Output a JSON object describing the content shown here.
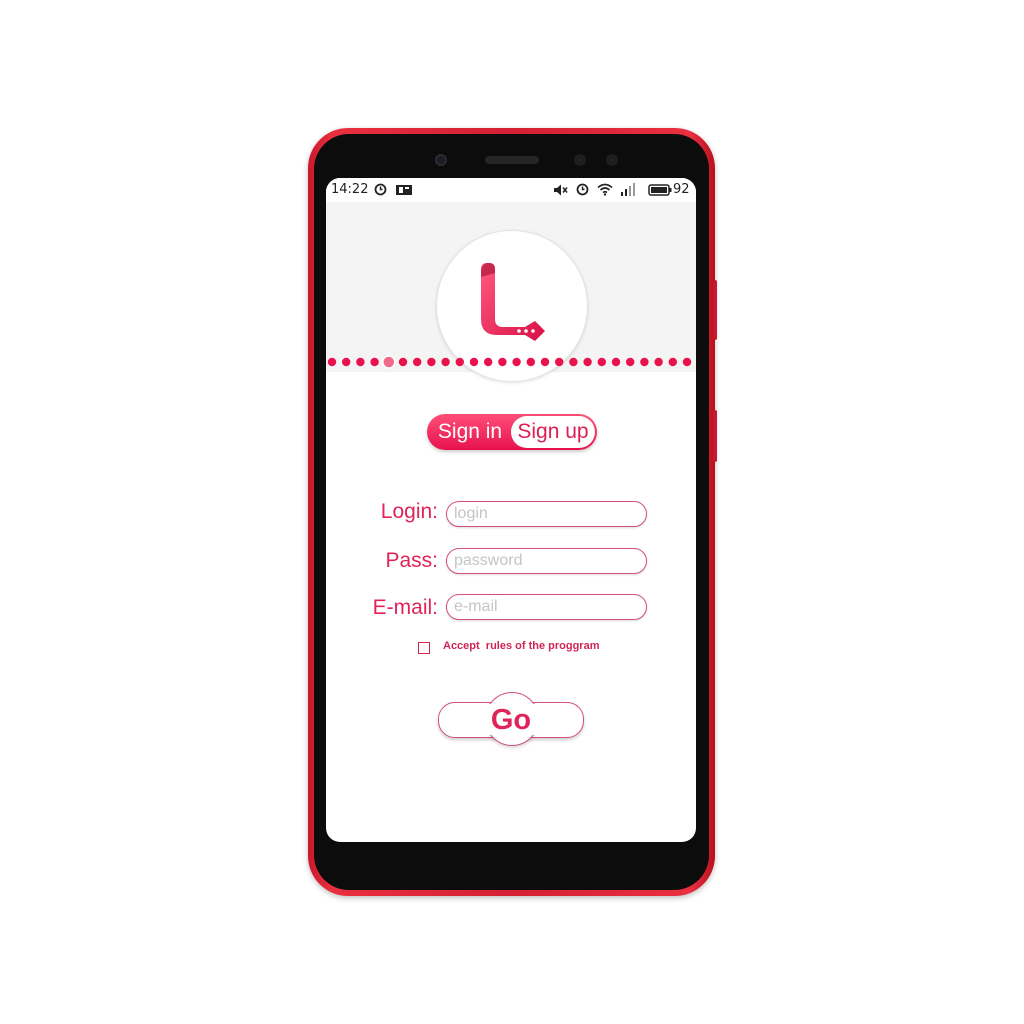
{
  "statusbar": {
    "time": "14:22",
    "battery_level": "92",
    "icons": [
      "alarm-clock-icon",
      "notification-icon",
      "mute-icon",
      "alarm-clock-icon",
      "wifi-icon",
      "signal-icon",
      "battery-icon"
    ]
  },
  "colors": {
    "accent": "#e8124c",
    "accent_light": "#ff4f79",
    "phone_body": "#d42034",
    "header_bg": "#f4f4f4"
  },
  "logo": {
    "icon": "logo-icon"
  },
  "carousel": {
    "active_index": 4
  },
  "tabs": {
    "signin_label": "Sign in",
    "signup_label": "Sign up",
    "selected": "Sign up"
  },
  "form": {
    "login_label": "Login:",
    "login_placeholder": "login",
    "pass_label": "Pass:",
    "pass_placeholder": "password",
    "email_label": "E-mail:",
    "email_placeholder": "e-mail",
    "accept_label": "Accept  rules of the proggram",
    "accept_checked": false
  },
  "go_button": {
    "label": "Go"
  }
}
